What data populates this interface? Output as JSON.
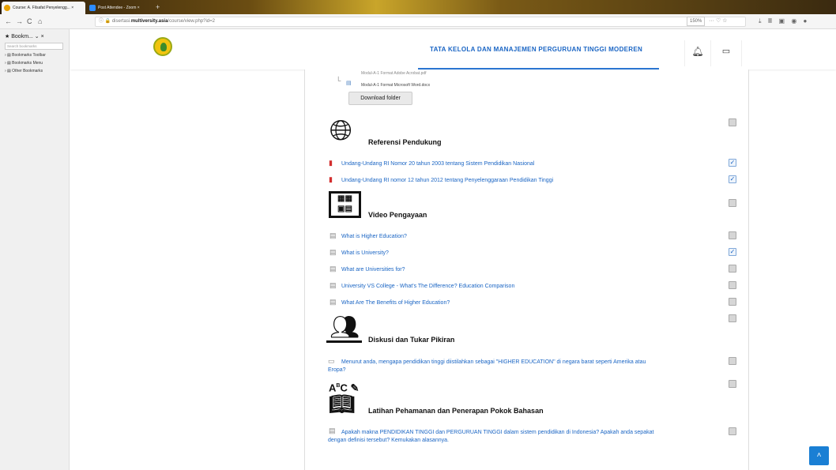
{
  "browser": {
    "tabs": [
      {
        "label": "Course: A. Filsafat Penyelengg... ×"
      },
      {
        "label": "Post Attendee - Zoom ×"
      }
    ],
    "url_prefix": "disertasi.",
    "url_domain": "multiversity.asia",
    "url_path": "/course/view.php?id=2",
    "zoom": "150%",
    "page_actions": "··· ♡ ☆"
  },
  "bookmarks": {
    "title": "Bookm... ⌄ ×",
    "search_placeholder": "Search bookmarks",
    "items": [
      "Bookmarks Toolbar",
      "Bookmarks Menu",
      "Other Bookmarks"
    ]
  },
  "course": {
    "title": "TATA KELOLA DAN MANAJEMEN PERGURUAN TINGGI MODEREN"
  },
  "folder": {
    "file_top": "Modul-A-1 Format Adobe Acrobat.pdf",
    "file": "Modul-A-1 Format Microsoft Word.docx",
    "download_label": "Download folder"
  },
  "sections": [
    {
      "title": "Referensi Pendukung",
      "icon": "globe-icon",
      "items": [
        {
          "text": "Undang-Undang RI Nomor 20 tahun 2003 tentang Sistem Pendidikan Nasional",
          "type": "pdf",
          "completed": true
        },
        {
          "text": "Undang-Undang RI nomor 12 tahun 2012 tentang Penyelenggaraan Pendidikan Tinggi",
          "type": "pdf",
          "completed": true
        }
      ]
    },
    {
      "title": "Video Pengayaan",
      "icon": "video-board-icon",
      "items": [
        {
          "text": "What is Higher Education?",
          "type": "page",
          "completed": false
        },
        {
          "text": "What is University?",
          "type": "page",
          "completed": true
        },
        {
          "text": "What are Universities for?",
          "type": "page",
          "completed": false
        },
        {
          "text": "University VS College - What's The Difference? Education Comparison",
          "type": "page",
          "completed": false
        },
        {
          "text": "What Are The Benefits of Higher Education?",
          "type": "page",
          "completed": false
        }
      ]
    },
    {
      "title": "Diskusi dan Tukar Pikiran",
      "icon": "discussion-icon",
      "items": [
        {
          "text_line1": "Menurut anda, mengapa pendidikan tinggi diistilahkan sebagai \"HIGHER EDUCATION\" di negara barat seperti Amerika atau",
          "text_line2": "Eropa?",
          "type": "forum",
          "completed": false
        }
      ]
    },
    {
      "title": "Latihan Pehamanan dan Penerapan Pokok Bahasan",
      "icon": "abc-book-icon",
      "items": [
        {
          "text_line1": "Apakah makna PENDIDIKAN TINGGI dan PERGURUAN TINGGI dalam sistem pendidikan di Indonesia? Apakah anda sepakat",
          "text_line2": "dengan definisi tersebut? Kemukakan alasannya.",
          "type": "assignment",
          "completed": false
        }
      ]
    }
  ],
  "icons": {
    "pdf": "pdf-icon",
    "page": "page-icon",
    "forum": "chat-bubble-icon",
    "assignment": "assignment-icon",
    "bell": "bell-icon",
    "message": "message-icon",
    "back_to_top": "chevron-up-icon"
  },
  "colors": {
    "link": "#1a65c4",
    "accent": "#1a7fd4"
  }
}
